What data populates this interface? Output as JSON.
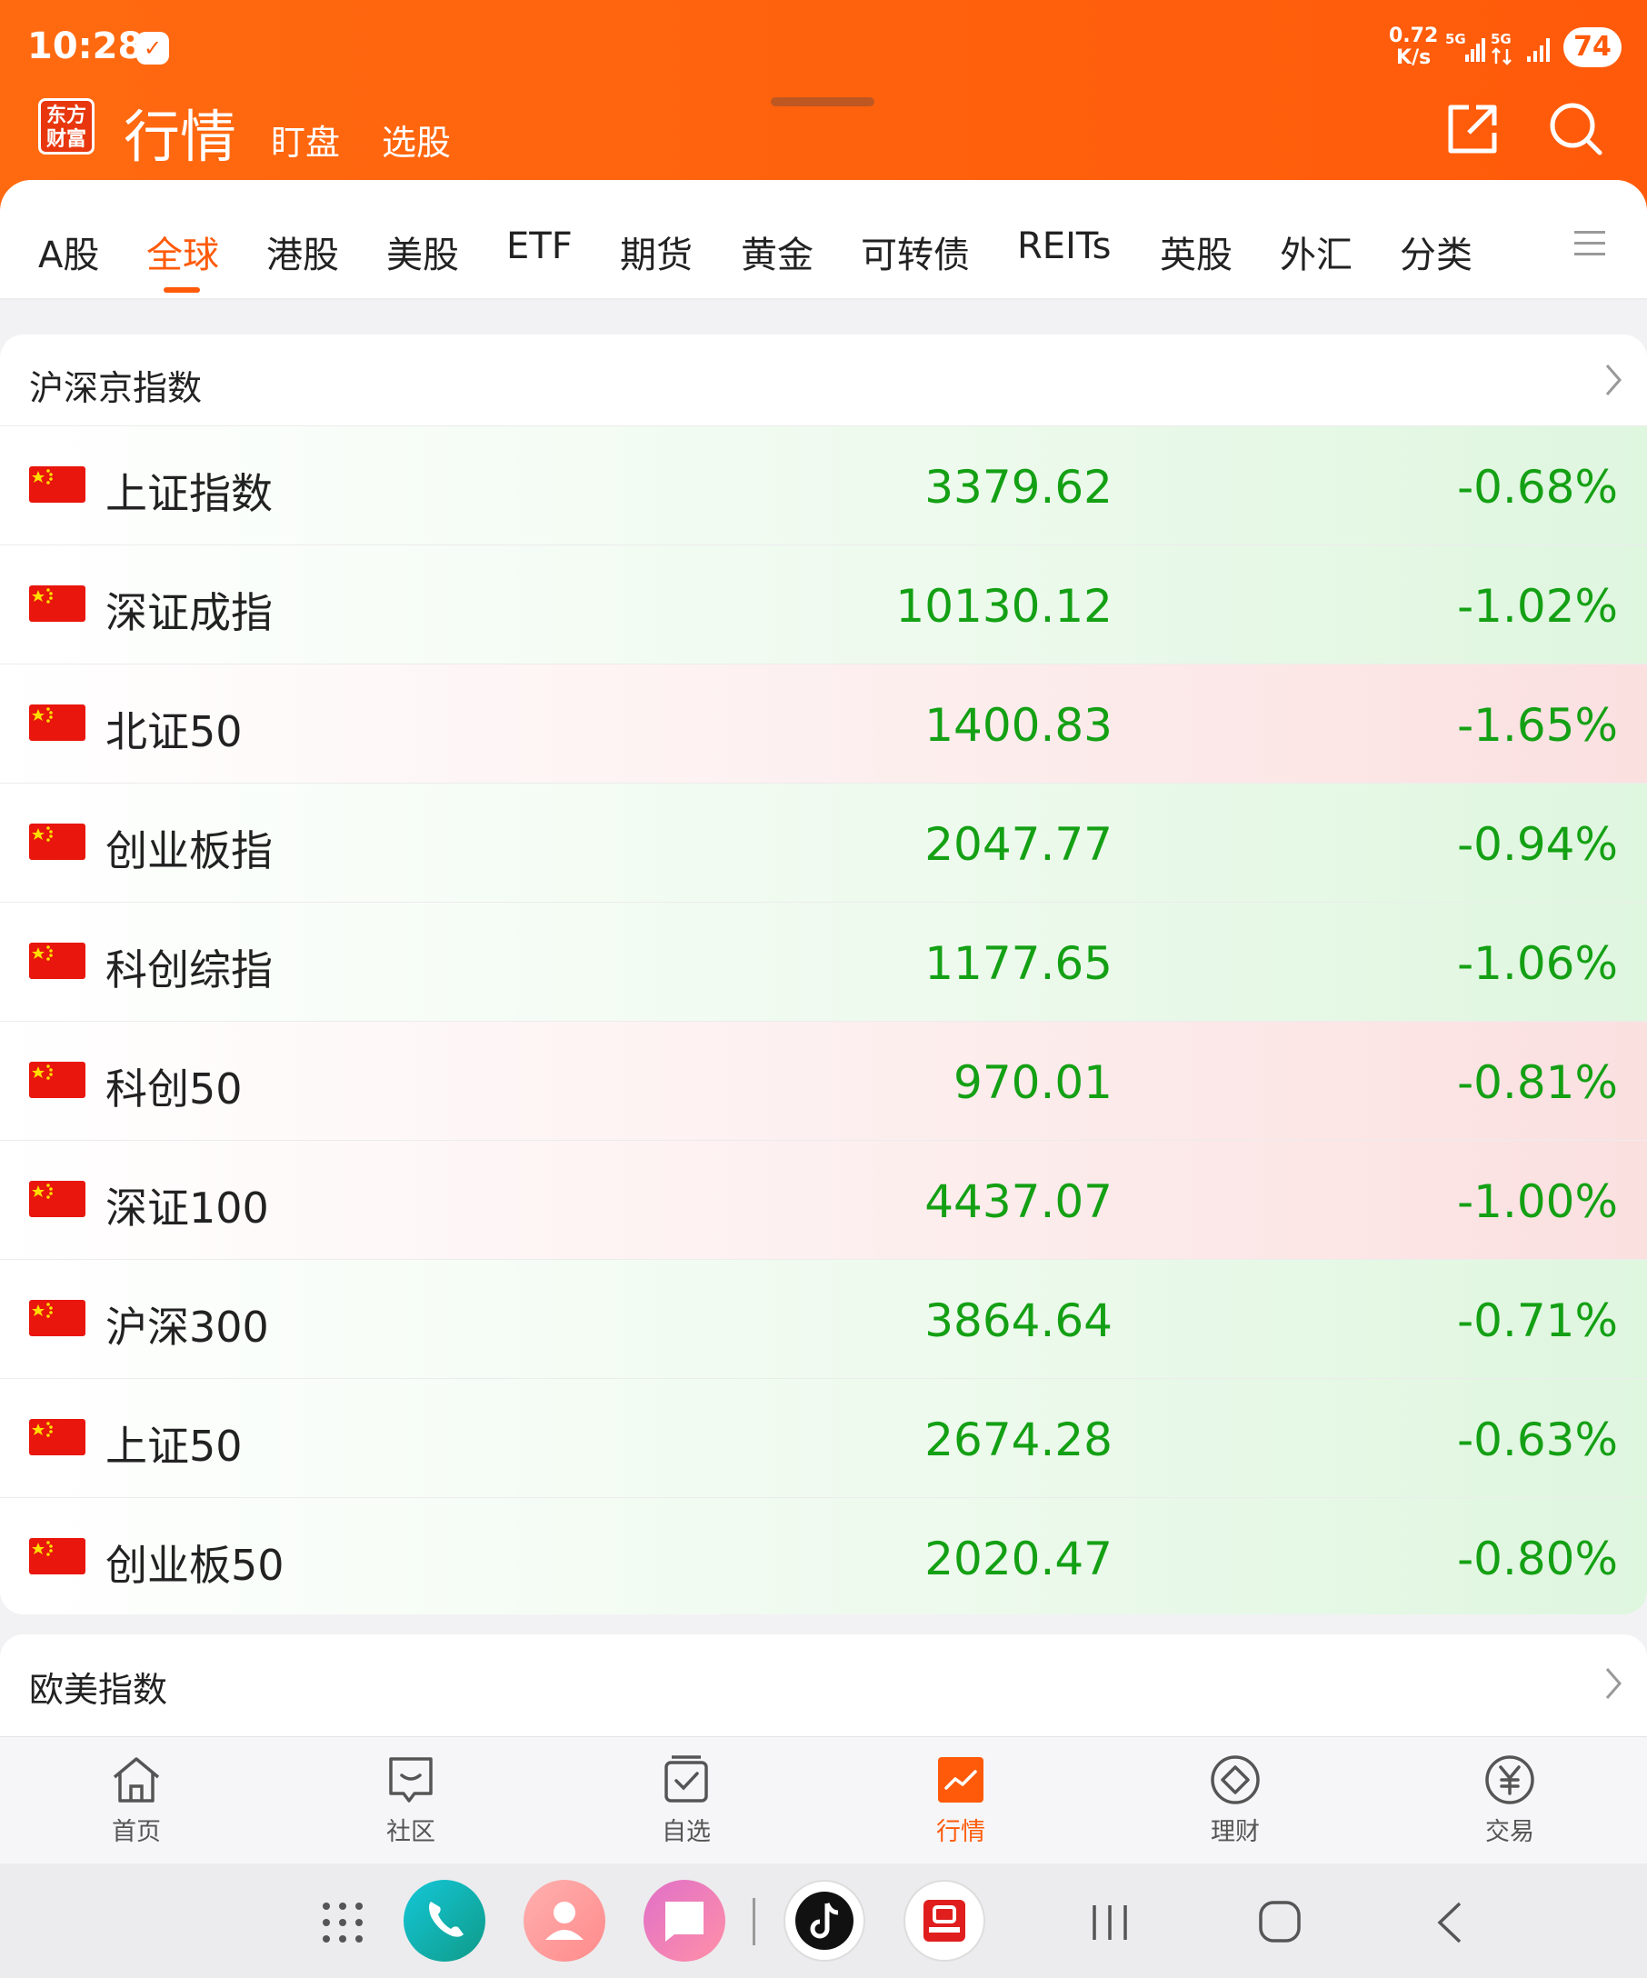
{
  "status_bar": {
    "time": "10:28",
    "net_speed_value": "0.72",
    "net_speed_unit": "K/s",
    "network_1": "5G",
    "network_2": "5G",
    "battery": "74"
  },
  "header": {
    "logo_line1": "东方",
    "logo_line2": "财富",
    "title": "行情",
    "subnav": [
      "盯盘",
      "选股"
    ]
  },
  "tabs": [
    {
      "label": "A股",
      "active": false
    },
    {
      "label": "全球",
      "active": true
    },
    {
      "label": "港股",
      "active": false
    },
    {
      "label": "美股",
      "active": false
    },
    {
      "label": "ETF",
      "active": false
    },
    {
      "label": "期货",
      "active": false
    },
    {
      "label": "黄金",
      "active": false
    },
    {
      "label": "可转债",
      "active": false
    },
    {
      "label": "REITs",
      "active": false
    },
    {
      "label": "英股",
      "active": false
    },
    {
      "label": "外汇",
      "active": false
    },
    {
      "label": "分类",
      "active": false
    }
  ],
  "section_cn": {
    "title": "沪深京指数",
    "rows": [
      {
        "name": "上证指数",
        "price": "3379.62",
        "change": "-0.68%",
        "tint": "down"
      },
      {
        "name": "深证成指",
        "price": "10130.12",
        "change": "-1.02%",
        "tint": "down"
      },
      {
        "name": "北证50",
        "price": "1400.83",
        "change": "-1.65%",
        "tint": "up"
      },
      {
        "name": "创业板指",
        "price": "2047.77",
        "change": "-0.94%",
        "tint": "down"
      },
      {
        "name": "科创综指",
        "price": "1177.65",
        "change": "-1.06%",
        "tint": "down"
      },
      {
        "name": "科创50",
        "price": "970.01",
        "change": "-0.81%",
        "tint": "up"
      },
      {
        "name": "深证100",
        "price": "4437.07",
        "change": "-1.00%",
        "tint": "up"
      },
      {
        "name": "沪深300",
        "price": "3864.64",
        "change": "-0.71%",
        "tint": "down"
      },
      {
        "name": "上证50",
        "price": "2674.28",
        "change": "-0.63%",
        "tint": "down"
      },
      {
        "name": "创业板50",
        "price": "2020.47",
        "change": "-0.80%",
        "tint": "down"
      }
    ]
  },
  "section_eu": {
    "title": "欧美指数"
  },
  "bottom_tabs": [
    {
      "label": "首页",
      "icon": "home-icon",
      "active": false
    },
    {
      "label": "社区",
      "icon": "community-icon",
      "active": false
    },
    {
      "label": "自选",
      "icon": "watchlist-icon",
      "active": false
    },
    {
      "label": "行情",
      "icon": "market-icon",
      "active": true
    },
    {
      "label": "理财",
      "icon": "wealth-icon",
      "active": false
    },
    {
      "label": "交易",
      "icon": "trade-icon",
      "active": false
    }
  ],
  "dock_icons": [
    "apps-grid-icon",
    "phone-icon",
    "contacts-icon",
    "messages-icon",
    "tiktok-icon",
    "securities-app-icon"
  ],
  "colors": {
    "brand_orange": "#ff5a0a",
    "fall_green": "#14a014",
    "flag_red": "#e8160c"
  }
}
